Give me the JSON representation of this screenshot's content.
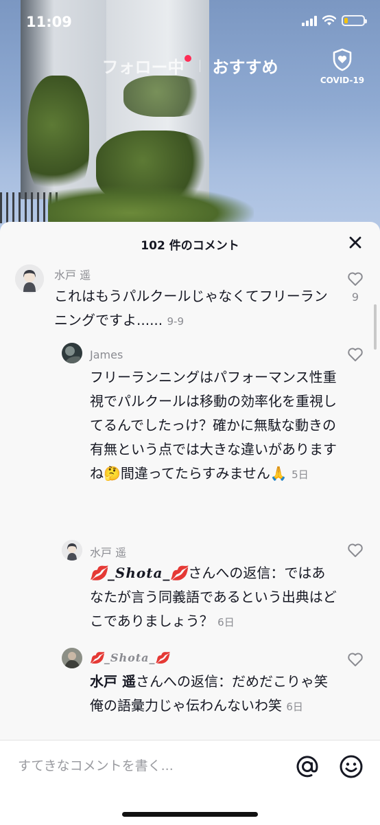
{
  "status_bar": {
    "time": "11:09",
    "battery_level": 0.2
  },
  "top_nav": {
    "following": "フォロー中",
    "recommended": "おすすめ",
    "covid_label": "COVID-19"
  },
  "comments_sheet": {
    "title": "102 件のコメント",
    "comments": [
      {
        "username": "水戸 遥",
        "text": "これはもうパルクールじゃなくてフリーランニングですよ......",
        "date": "9-9",
        "likes": "9"
      },
      {
        "username": "James",
        "text": "フリーランニングはパフォーマンス性重視でパルクールは移動の効率化を重視してるんでしたっけ？確かに無駄な動きの有無という点では大きな違いがありますね🤔間違ってたらすみません🙏",
        "date": "5日"
      },
      {
        "username": "水戸 遥",
        "reply_to_name": "💋_𝑺𝒉𝒐𝒕𝒂_💋",
        "reply_suffix": "さんへの返信：ではあなたが言う同義語であるという出典はどこでありましょう？",
        "date": "6日"
      },
      {
        "username": "💋_𝑺𝒉𝒐𝒕𝒂_💋",
        "reply_to_name": "水戸 遥",
        "reply_suffix": "さんへの返信：だめだこりゃ笑",
        "text_line2": "俺の語彙力じゃ伝わんないわ笑",
        "date": "6日"
      }
    ]
  },
  "input_bar": {
    "placeholder": "すてきなコメントを書く..."
  },
  "icons": {
    "close": "close-icon",
    "like": "heart-outline-icon",
    "mention": "at-sign-icon",
    "emoji": "smiley-icon",
    "covid": "shield-heart-icon"
  }
}
